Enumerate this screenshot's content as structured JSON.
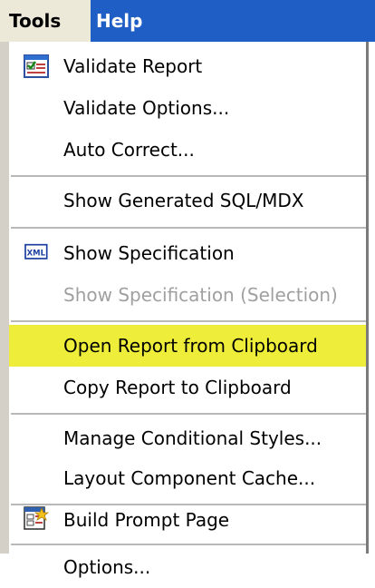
{
  "menubar": {
    "tools": "Tools",
    "help": "Help"
  },
  "menu": {
    "items": [
      {
        "label": "Validate Report",
        "icon": "validate-report-icon"
      },
      {
        "label": "Validate Options..."
      },
      {
        "label": "Auto Correct..."
      },
      {
        "label": "Show Generated SQL/MDX"
      },
      {
        "label": "Show Specification",
        "icon": "xml-icon",
        "icon_text": "XML"
      },
      {
        "label": "Show Specification (Selection)",
        "disabled": true
      },
      {
        "label": "Open Report from Clipboard",
        "highlighted": true
      },
      {
        "label": "Copy Report to Clipboard"
      },
      {
        "label": "Manage Conditional Styles..."
      },
      {
        "label": "Layout Component Cache..."
      },
      {
        "label": "Build Prompt Page",
        "icon": "build-prompt-page-icon"
      },
      {
        "label": "Options..."
      }
    ]
  },
  "colors": {
    "menubar_bg": "#1f5fc5",
    "highlight": "#eeee3a",
    "disabled_text": "#a0a0a0"
  }
}
